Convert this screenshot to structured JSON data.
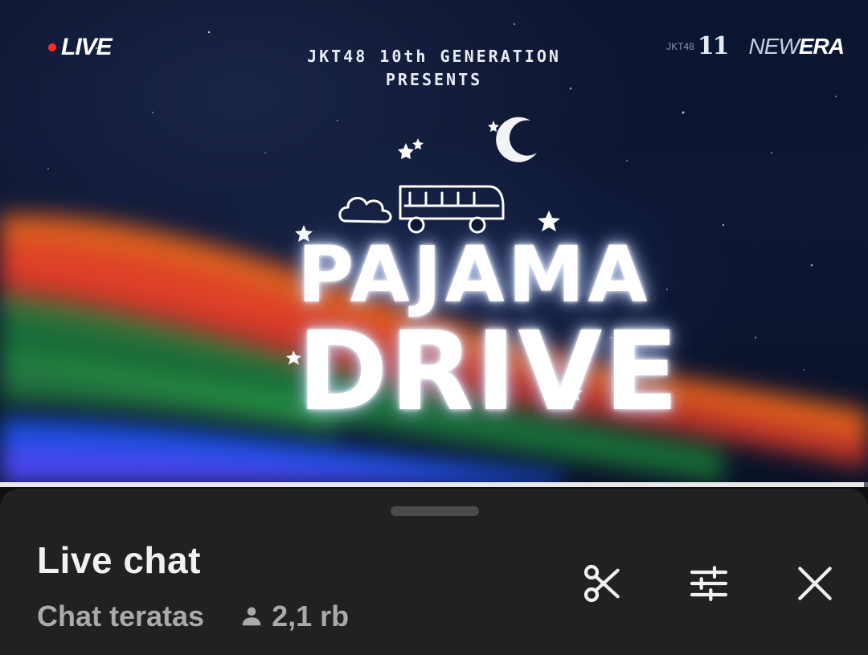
{
  "video": {
    "live_badge": "LIVE",
    "presents_line1": "JKT48 10th GENERATION",
    "presents_line2": "PRESENTS",
    "anniversary_mark": "JKT48",
    "anniversary_number": "11",
    "era_prefix": "NEW",
    "era_suffix": "ERA",
    "title_line1": "PAJAMA",
    "title_line2": "DRIVE",
    "progress_fraction": 0.995
  },
  "live_chat": {
    "title": "Live chat",
    "mode_label": "Chat teratas",
    "viewer_count": "2,1 rb",
    "actions": [
      {
        "name": "clip",
        "icon": "scissors-icon"
      },
      {
        "name": "filter",
        "icon": "sliders-icon"
      },
      {
        "name": "close",
        "icon": "close-icon"
      }
    ]
  },
  "colors": {
    "sheet_background": "#212121",
    "title_text": "#f1f1f1",
    "secondary_text": "#aaaaaa",
    "live_dot": "#ff2b2b"
  }
}
